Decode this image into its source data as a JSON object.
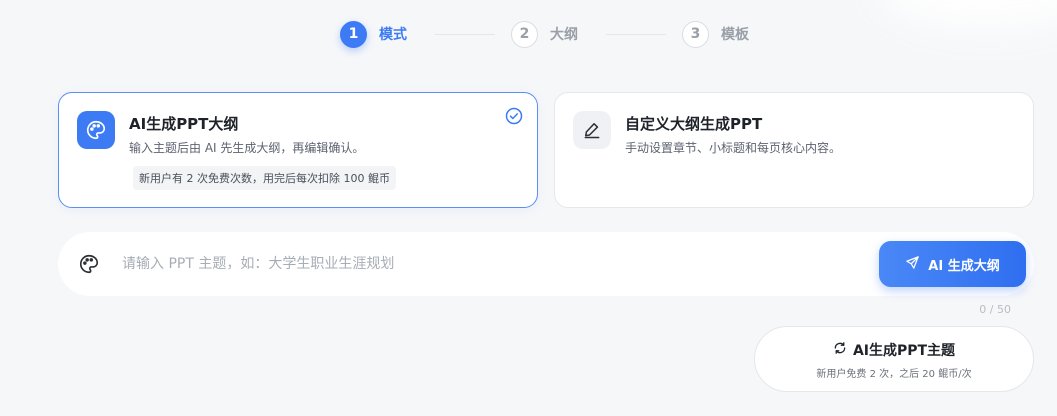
{
  "stepper": {
    "steps": [
      {
        "num": "1",
        "label": "模式"
      },
      {
        "num": "2",
        "label": "大纲"
      },
      {
        "num": "3",
        "label": "模板"
      }
    ],
    "active_step": 1
  },
  "modes": {
    "ai": {
      "title": "AI生成PPT大纲",
      "desc": "输入主题后由 AI 先生成大纲，再编辑确认。",
      "badge": "新用户有 2 次免费次数，用完后每次扣除 100 鲲币",
      "icon": "palette-icon",
      "selected": true
    },
    "custom": {
      "title": "自定义大纲生成PPT",
      "desc": "手动设置章节、小标题和每页核心内容。",
      "icon": "edit-icon",
      "selected": false
    }
  },
  "topic_input": {
    "placeholder": "请输入 PPT 主题，如：大学生职业生涯规划",
    "value": "",
    "icon": "palette-icon"
  },
  "generate_button": {
    "label": "AI 生成大纲",
    "icon": "send-icon"
  },
  "char_count": "0 / 50",
  "theme_button": {
    "title": "AI生成PPT主题",
    "subtitle": "新用户免费 2 次，之后 20 鲲币/次",
    "icon": "refresh-icon"
  },
  "colors": {
    "accent": "#3d7bf5",
    "background": "#f6f7f9"
  }
}
